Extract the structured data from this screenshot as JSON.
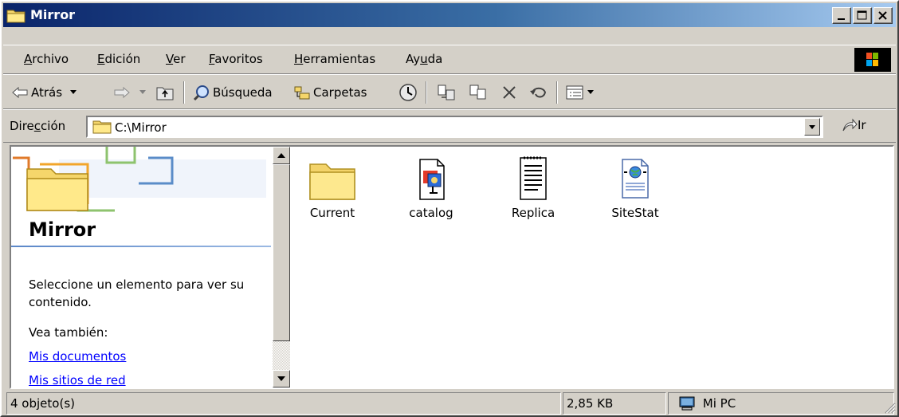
{
  "window": {
    "title": "Mirror",
    "buttons": [
      "minimize",
      "maximize",
      "close"
    ]
  },
  "menu": {
    "items": [
      {
        "label": "Archivo",
        "accel": "A"
      },
      {
        "label": "Edición",
        "accel": "E"
      },
      {
        "label": "Ver",
        "accel": "V"
      },
      {
        "label": "Favoritos",
        "accel": "F"
      },
      {
        "label": "Herramientas",
        "accel": "H"
      },
      {
        "label": "Ayuda",
        "accel": "u"
      }
    ]
  },
  "toolbar": {
    "back_label": "Atrás",
    "search_label": "Búsqueda",
    "folders_label": "Carpetas"
  },
  "address": {
    "label": "Dirección",
    "value": "C:\\Mirror",
    "go_label": "Ir"
  },
  "leftpane": {
    "title": "Mirror",
    "description": "Seleccione un elemento para ver su contenido.",
    "see_also": "Vea también:",
    "links": [
      "Mis documentos",
      "Mis sitios de red"
    ]
  },
  "files": [
    {
      "name": "Current",
      "icon": "folder-icon"
    },
    {
      "name": "catalog",
      "icon": "catalog-file-icon"
    },
    {
      "name": "Replica",
      "icon": "text-document-icon"
    },
    {
      "name": "SiteStat",
      "icon": "web-document-icon"
    }
  ],
  "status": {
    "count": "4 objeto(s)",
    "size": "2,85 KB",
    "zone": "Mi PC"
  },
  "colors": {
    "title_start": "#0a246a",
    "title_end": "#a6caf0",
    "face": "#d4d0c8",
    "link": "#0000ff"
  }
}
